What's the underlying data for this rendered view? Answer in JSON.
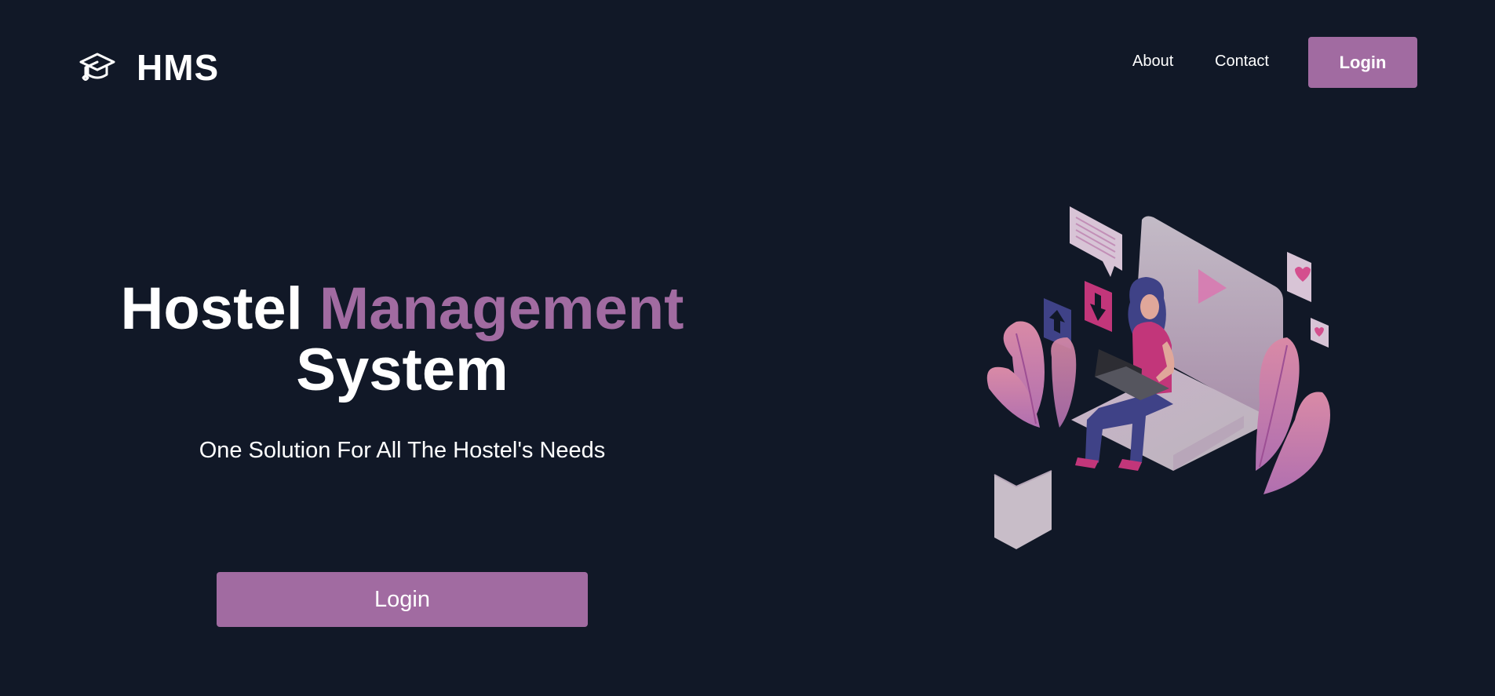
{
  "brand": {
    "name": "HMS",
    "icon": "graduation-cap-icon"
  },
  "nav": {
    "links": [
      {
        "label": "About"
      },
      {
        "label": "Contact"
      }
    ],
    "login_label": "Login"
  },
  "hero": {
    "title_part1": "Hostel",
    "title_accent": "Management",
    "title_part2": "System",
    "subtitle": "One Solution For All The Hostel's Needs",
    "login_label": "Login",
    "illustration": "woman-with-laptop-illustration"
  },
  "colors": {
    "background": "#111827",
    "accent": "#a16ba1",
    "text": "#ffffff"
  }
}
